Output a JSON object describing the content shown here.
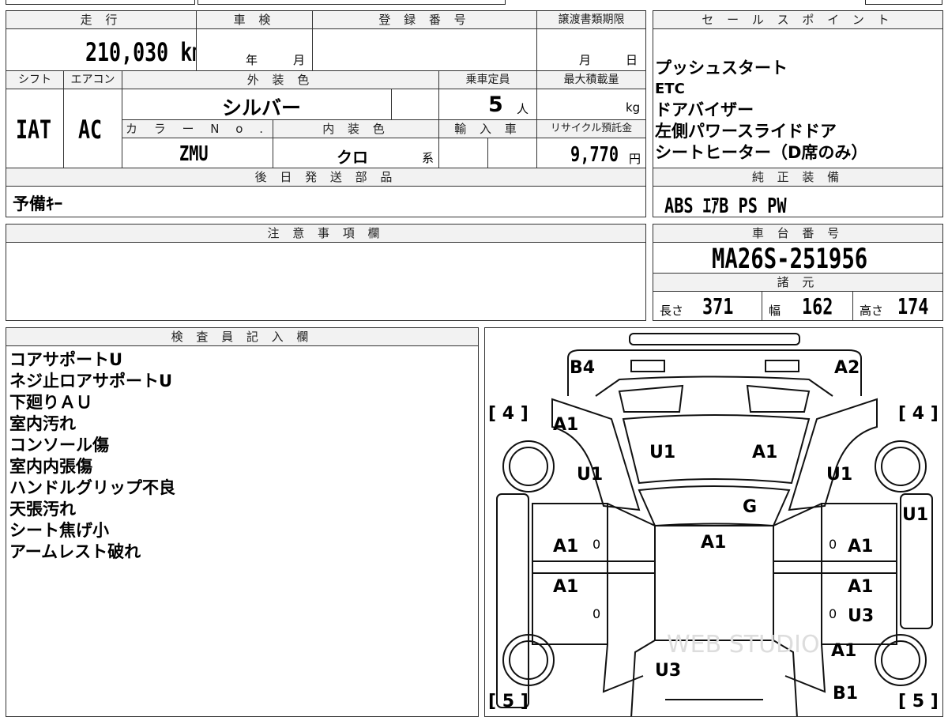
{
  "header_row": {
    "mileage_label": "走 行",
    "mileage_value": "210,030 km",
    "inspection_label": "車 検",
    "inspection_year_unit": "年",
    "inspection_month_unit": "月",
    "registration_label": "登 録 番 号",
    "registration_value": "",
    "transfer_deadline_label": "譲渡書類期限",
    "transfer_month_unit": "月",
    "transfer_day_unit": "日"
  },
  "vehicle": {
    "shift_label": "シフト",
    "shift_value": "IAT",
    "ac_label": "エアコン",
    "ac_value": "AC",
    "exterior_color_label": "外 装 色",
    "exterior_color_value": "シルバー",
    "capacity_label": "乗車定員",
    "capacity_value": "5",
    "capacity_unit": "人",
    "max_load_label": "最大積載量",
    "max_load_unit": "kg",
    "color_no_label": "カ ラ ー N o .",
    "color_no_value": "ZMU",
    "interior_color_label": "内 装 色",
    "interior_color_value": "クロ",
    "interior_color_suffix": "系",
    "import_label": "輸 入 車",
    "recycle_label": "リサイクル預託金",
    "recycle_value": "9,770",
    "recycle_unit": "円"
  },
  "later_parts": {
    "label": "後 日 発 送 部 品",
    "value": "予備ｷｰ"
  },
  "sales_points": {
    "label": "セ ー ル ス ポ イ ン ト",
    "items": [
      "プッシュスタート",
      "ETC",
      "ドアバイザー",
      "左側パワースライドドア",
      "シートヒーター（D席のみ）"
    ]
  },
  "genuine_equipment": {
    "label": "純 正 装 備",
    "value": "ABS ｴｱB PS PW"
  },
  "notes": {
    "label": "注 意 事 項 欄",
    "value": ""
  },
  "chassis": {
    "label": "車 台 番 号",
    "value": "MA26S-251956"
  },
  "specs": {
    "label": "諸 元",
    "length_label": "長さ",
    "length_value": "371",
    "width_label": "幅",
    "width_value": "162",
    "height_label": "高さ",
    "height_value": "174"
  },
  "inspector": {
    "label": "検 査 員 記 入 欄",
    "items": [
      "コアサポートU",
      "ネジ止ロアサポートU",
      "下廻りＡＵ",
      "室内汚れ",
      "コンソール傷",
      "室内内張傷",
      "ハンドルグリップ不良",
      "天張汚れ",
      "シート焦げ小",
      "アームレスト破れ"
    ]
  },
  "diagram": {
    "tires": {
      "front_left": "4",
      "front_right": "4",
      "rear_left": "5",
      "rear_right": "5"
    },
    "marks": {
      "b4": "B4",
      "a2": "A2",
      "a1_fender_l": "A1",
      "u1_hood": "U1",
      "a1_hood": "A1",
      "u1_fender_l": "U1",
      "u1_fender_r": "U1",
      "g_windshield": "G",
      "u1_side_r": "U1",
      "a1_roof": "A1",
      "a1_door_fl": "A1",
      "a1_door_fr": "A1",
      "a1_door_rl": "A1",
      "a1_door_rr": "A1",
      "u3_door_rr": "U3",
      "u3_rear": "U3",
      "a1_quarter_r": "A1",
      "b1": "B1",
      "zero_1": "0",
      "zero_2": "0",
      "zero_3": "0",
      "zero_4": "0"
    },
    "watermark": "WEB STUDIO"
  }
}
